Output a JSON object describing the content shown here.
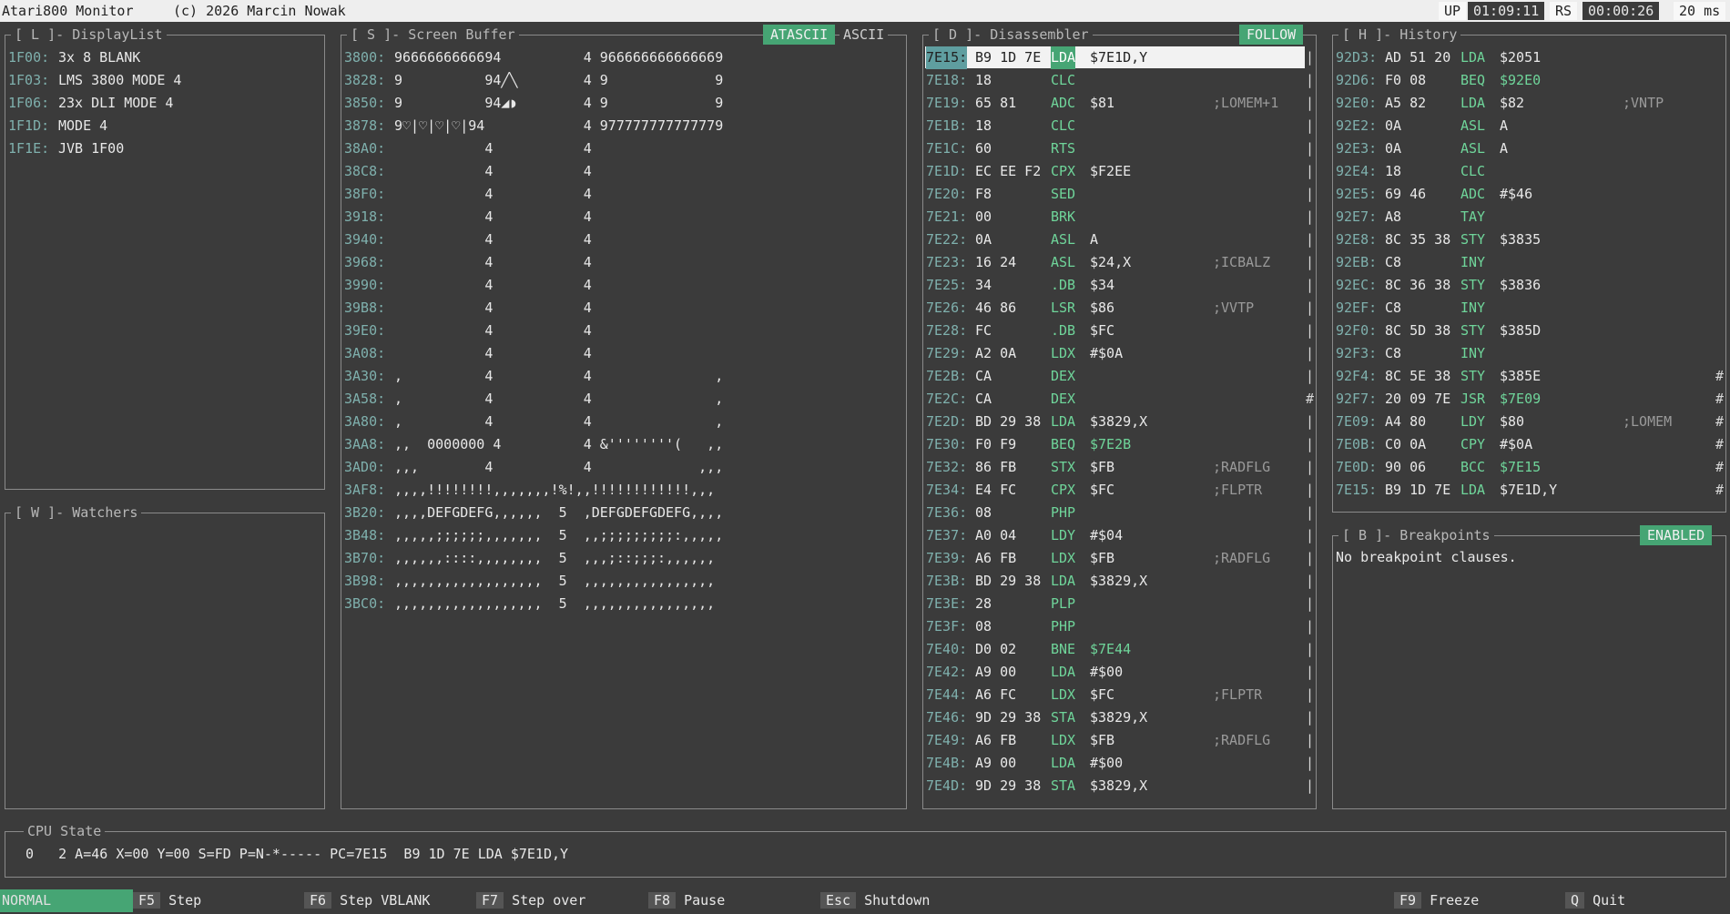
{
  "topbar": {
    "app": "Atari800 Monitor",
    "copyright": "(c) 2026 Marcin Nowak",
    "up_label": "UP",
    "up_time": "01:09:11",
    "rs_label": "RS",
    "rs_time": "00:00:26",
    "frame": "20 ms"
  },
  "displaylist": {
    "title": "[ L ]- DisplayList",
    "rows": [
      {
        "addr": "1F00:",
        "text": "3x 8 BLANK"
      },
      {
        "addr": "1F03:",
        "text": "LMS 3800 MODE 4"
      },
      {
        "addr": "1F06:",
        "text": "23x DLI MODE 4"
      },
      {
        "addr": "1F1D:",
        "text": "MODE 4"
      },
      {
        "addr": "1F1E:",
        "text": "JVB 1F00"
      }
    ]
  },
  "watchers": {
    "title": "[ W ]- Watchers"
  },
  "screenbuf": {
    "title": "[ S ]- Screen Buffer",
    "tab_active": "ATASCII",
    "tab_other": "ASCII",
    "rows": [
      {
        "addr": "3800:",
        "text": "9666666666694          4 966666666666669"
      },
      {
        "addr": "3828:",
        "text": "9          94╱╲        4 9             9"
      },
      {
        "addr": "3850:",
        "text": "9          94◢◗        4 9             9"
      },
      {
        "addr": "3878:",
        "text": "9♡|♡|♡|♡|94            4 977777777777779"
      },
      {
        "addr": "38A0:",
        "text": "           4           4"
      },
      {
        "addr": "38C8:",
        "text": "           4           4"
      },
      {
        "addr": "38F0:",
        "text": "           4           4"
      },
      {
        "addr": "3918:",
        "text": "           4           4"
      },
      {
        "addr": "3940:",
        "text": "           4           4"
      },
      {
        "addr": "3968:",
        "text": "           4           4"
      },
      {
        "addr": "3990:",
        "text": "           4           4"
      },
      {
        "addr": "39B8:",
        "text": "           4           4"
      },
      {
        "addr": "39E0:",
        "text": "           4           4"
      },
      {
        "addr": "3A08:",
        "text": "           4           4"
      },
      {
        "addr": "3A30:",
        "text": ",          4           4               ,"
      },
      {
        "addr": "3A58:",
        "text": ",          4           4               ,"
      },
      {
        "addr": "3A80:",
        "text": ",          4           4               ,"
      },
      {
        "addr": "3AA8:",
        "text": ",,  0000000 4          4 &''''''''(   ,,"
      },
      {
        "addr": "3AD0:",
        "text": ",,,        4           4             ,,,"
      },
      {
        "addr": "3AF8:",
        "text": ",,,,!!!!!!!!,,,,,,,!%!,,!!!!!!!!!!!!,,,"
      },
      {
        "addr": "3B20:",
        "text": ",,,,DEFGDEFG,,,,,,  5  ,DEFGDEFGDEFG,,,,"
      },
      {
        "addr": "3B48:",
        "text": ",,,,,;;;;;;,,,,,,,  5  ,,;;;;;;;;;:,,,,,"
      },
      {
        "addr": "3B70:",
        "text": ",,,,,,::::,,,,,,,,  5  ,,,;::;;;:,,,,,,"
      },
      {
        "addr": "3B98:",
        "text": ",,,,,,,,,,,,,,,,,,  5  ,,,,,,,,,,,,,,,,"
      },
      {
        "addr": "3BC0:",
        "text": ",,,,,,,,,,,,,,,,,,  5  ,,,,,,,,,,,,,,,,"
      }
    ]
  },
  "disasm": {
    "title": "[ D ]- Disassembler",
    "badge": "FOLLOW",
    "rows": [
      {
        "addr": "7E15:",
        "bytes": "B9 1D 7E",
        "mn": "LDA",
        "op": "$7E1D,Y",
        "cm": "",
        "bar": "|",
        "sel": true
      },
      {
        "addr": "7E18:",
        "bytes": "18",
        "mn": "CLC",
        "op": "",
        "cm": "",
        "bar": "|"
      },
      {
        "addr": "7E19:",
        "bytes": "65 81",
        "mn": "ADC",
        "op": "$81",
        "cm": ";LOMEM+1",
        "bar": "|"
      },
      {
        "addr": "7E1B:",
        "bytes": "18",
        "mn": "CLC",
        "op": "",
        "cm": "",
        "bar": "|"
      },
      {
        "addr": "7E1C:",
        "bytes": "60",
        "mn": "RTS",
        "op": "",
        "cm": "",
        "bar": "|"
      },
      {
        "addr": "7E1D:",
        "bytes": "EC EE F2",
        "mn": "CPX",
        "op": "$F2EE",
        "cm": "",
        "bar": "|"
      },
      {
        "addr": "7E20:",
        "bytes": "F8",
        "mn": "SED",
        "op": "",
        "cm": "",
        "bar": "|"
      },
      {
        "addr": "7E21:",
        "bytes": "00",
        "mn": "BRK",
        "op": "",
        "cm": "",
        "bar": "|"
      },
      {
        "addr": "7E22:",
        "bytes": "0A",
        "mn": "ASL",
        "op": "A",
        "cm": "",
        "bar": "|"
      },
      {
        "addr": "7E23:",
        "bytes": "16 24",
        "mn": "ASL",
        "op": "$24,X",
        "cm": ";ICBALZ",
        "bar": "|"
      },
      {
        "addr": "7E25:",
        "bytes": "34",
        "mn": ".DB",
        "op": "$34",
        "cm": "",
        "bar": "|"
      },
      {
        "addr": "7E26:",
        "bytes": "46 86",
        "mn": "LSR",
        "op": "$86",
        "cm": ";VVTP",
        "bar": "|"
      },
      {
        "addr": "7E28:",
        "bytes": "FC",
        "mn": ".DB",
        "op": "$FC",
        "cm": "",
        "bar": "|"
      },
      {
        "addr": "7E29:",
        "bytes": "A2 0A",
        "mn": "LDX",
        "op": "#$0A",
        "cm": "",
        "bar": "|"
      },
      {
        "addr": "7E2B:",
        "bytes": "CA",
        "mn": "DEX",
        "op": "",
        "cm": "",
        "bar": "|"
      },
      {
        "addr": "7E2C:",
        "bytes": "CA",
        "mn": "DEX",
        "op": "",
        "cm": "",
        "bar": "#"
      },
      {
        "addr": "7E2D:",
        "bytes": "BD 29 38",
        "mn": "LDA",
        "op": "$3829,X",
        "cm": "",
        "bar": "|"
      },
      {
        "addr": "7E30:",
        "bytes": "F0 F9",
        "mn": "BEQ",
        "op": "$7E2B",
        "cm": "",
        "bar": "|",
        "tgt": true
      },
      {
        "addr": "7E32:",
        "bytes": "86 FB",
        "mn": "STX",
        "op": "$FB",
        "cm": ";RADFLG",
        "bar": "|"
      },
      {
        "addr": "7E34:",
        "bytes": "E4 FC",
        "mn": "CPX",
        "op": "$FC",
        "cm": ";FLPTR",
        "bar": "|"
      },
      {
        "addr": "7E36:",
        "bytes": "08",
        "mn": "PHP",
        "op": "",
        "cm": "",
        "bar": "|"
      },
      {
        "addr": "7E37:",
        "bytes": "A0 04",
        "mn": "LDY",
        "op": "#$04",
        "cm": "",
        "bar": "|"
      },
      {
        "addr": "7E39:",
        "bytes": "A6 FB",
        "mn": "LDX",
        "op": "$FB",
        "cm": ";RADFLG",
        "bar": "|"
      },
      {
        "addr": "7E3B:",
        "bytes": "BD 29 38",
        "mn": "LDA",
        "op": "$3829,X",
        "cm": "",
        "bar": "|"
      },
      {
        "addr": "7E3E:",
        "bytes": "28",
        "mn": "PLP",
        "op": "",
        "cm": "",
        "bar": "|"
      },
      {
        "addr": "7E3F:",
        "bytes": "08",
        "mn": "PHP",
        "op": "",
        "cm": "",
        "bar": "|"
      },
      {
        "addr": "7E40:",
        "bytes": "D0 02",
        "mn": "BNE",
        "op": "$7E44",
        "cm": "",
        "bar": "|",
        "tgt": true
      },
      {
        "addr": "7E42:",
        "bytes": "A9 00",
        "mn": "LDA",
        "op": "#$00",
        "cm": "",
        "bar": "|"
      },
      {
        "addr": "7E44:",
        "bytes": "A6 FC",
        "mn": "LDX",
        "op": "$FC",
        "cm": ";FLPTR",
        "bar": "|"
      },
      {
        "addr": "7E46:",
        "bytes": "9D 29 38",
        "mn": "STA",
        "op": "$3829,X",
        "cm": "",
        "bar": "|"
      },
      {
        "addr": "7E49:",
        "bytes": "A6 FB",
        "mn": "LDX",
        "op": "$FB",
        "cm": ";RADFLG",
        "bar": "|"
      },
      {
        "addr": "7E4B:",
        "bytes": "A9 00",
        "mn": "LDA",
        "op": "#$00",
        "cm": "",
        "bar": "|"
      },
      {
        "addr": "7E4D:",
        "bytes": "9D 29 38",
        "mn": "STA",
        "op": "$3829,X",
        "cm": "",
        "bar": "|"
      }
    ]
  },
  "history": {
    "title": "[ H ]- History",
    "rows": [
      {
        "addr": "92D3:",
        "bytes": "AD 51 20",
        "mn": "LDA",
        "op": "$2051",
        "cm": "",
        "bar": ""
      },
      {
        "addr": "92D6:",
        "bytes": "F0 08",
        "mn": "BEQ",
        "op": "$92E0",
        "cm": "",
        "bar": "",
        "tgt": true
      },
      {
        "addr": "92E0:",
        "bytes": "A5 82",
        "mn": "LDA",
        "op": "$82",
        "cm": ";VNTP",
        "bar": ""
      },
      {
        "addr": "92E2:",
        "bytes": "0A",
        "mn": "ASL",
        "op": "A",
        "cm": "",
        "bar": ""
      },
      {
        "addr": "92E3:",
        "bytes": "0A",
        "mn": "ASL",
        "op": "A",
        "cm": "",
        "bar": ""
      },
      {
        "addr": "92E4:",
        "bytes": "18",
        "mn": "CLC",
        "op": "",
        "cm": "",
        "bar": ""
      },
      {
        "addr": "92E5:",
        "bytes": "69 46",
        "mn": "ADC",
        "op": "#$46",
        "cm": "",
        "bar": ""
      },
      {
        "addr": "92E7:",
        "bytes": "A8",
        "mn": "TAY",
        "op": "",
        "cm": "",
        "bar": ""
      },
      {
        "addr": "92E8:",
        "bytes": "8C 35 38",
        "mn": "STY",
        "op": "$3835",
        "cm": "",
        "bar": ""
      },
      {
        "addr": "92EB:",
        "bytes": "C8",
        "mn": "INY",
        "op": "",
        "cm": "",
        "bar": ""
      },
      {
        "addr": "92EC:",
        "bytes": "8C 36 38",
        "mn": "STY",
        "op": "$3836",
        "cm": "",
        "bar": ""
      },
      {
        "addr": "92EF:",
        "bytes": "C8",
        "mn": "INY",
        "op": "",
        "cm": "",
        "bar": ""
      },
      {
        "addr": "92F0:",
        "bytes": "8C 5D 38",
        "mn": "STY",
        "op": "$385D",
        "cm": "",
        "bar": ""
      },
      {
        "addr": "92F3:",
        "bytes": "C8",
        "mn": "INY",
        "op": "",
        "cm": "",
        "bar": ""
      },
      {
        "addr": "92F4:",
        "bytes": "8C 5E 38",
        "mn": "STY",
        "op": "$385E",
        "cm": "",
        "bar": "#"
      },
      {
        "addr": "92F7:",
        "bytes": "20 09 7E",
        "mn": "JSR",
        "op": "$7E09",
        "cm": "",
        "bar": "#",
        "tgt": true
      },
      {
        "addr": "7E09:",
        "bytes": "A4 80",
        "mn": "LDY",
        "op": "$80",
        "cm": ";LOMEM",
        "bar": "#"
      },
      {
        "addr": "7E0B:",
        "bytes": "C0 0A",
        "mn": "CPY",
        "op": "#$0A",
        "cm": "",
        "bar": "#"
      },
      {
        "addr": "7E0D:",
        "bytes": "90 06",
        "mn": "BCC",
        "op": "$7E15",
        "cm": "",
        "bar": "#",
        "tgt": true
      },
      {
        "addr": "7E15:",
        "bytes": "B9 1D 7E",
        "mn": "LDA",
        "op": "$7E1D,Y",
        "cm": "",
        "bar": "#"
      }
    ]
  },
  "breakpoints": {
    "title": "[ B ]- Breakpoints",
    "badge": "ENABLED",
    "text": "No breakpoint clauses."
  },
  "cpu": {
    "title": "CPU State",
    "text": "0   2 A=46 X=00 Y=00 S=FD P=N-*----- PC=7E15  B9 1D 7E LDA $7E1D,Y"
  },
  "footer": {
    "mode": "NORMAL",
    "keys": [
      {
        "k": "F5",
        "l": "Step"
      },
      {
        "k": "F6",
        "l": "Step VBLANK"
      },
      {
        "k": "F7",
        "l": "Step over"
      },
      {
        "k": "F8",
        "l": "Pause"
      },
      {
        "k": "Esc",
        "l": "Shutdown"
      },
      {
        "k": "F9",
        "l": "Freeze"
      },
      {
        "k": "Q",
        "l": "Quit"
      }
    ]
  },
  "colors": {
    "accent": "#46a574",
    "address": "#7fb0ad",
    "mnemonic": "#6fd59a",
    "bg": "#3b3b3b"
  }
}
